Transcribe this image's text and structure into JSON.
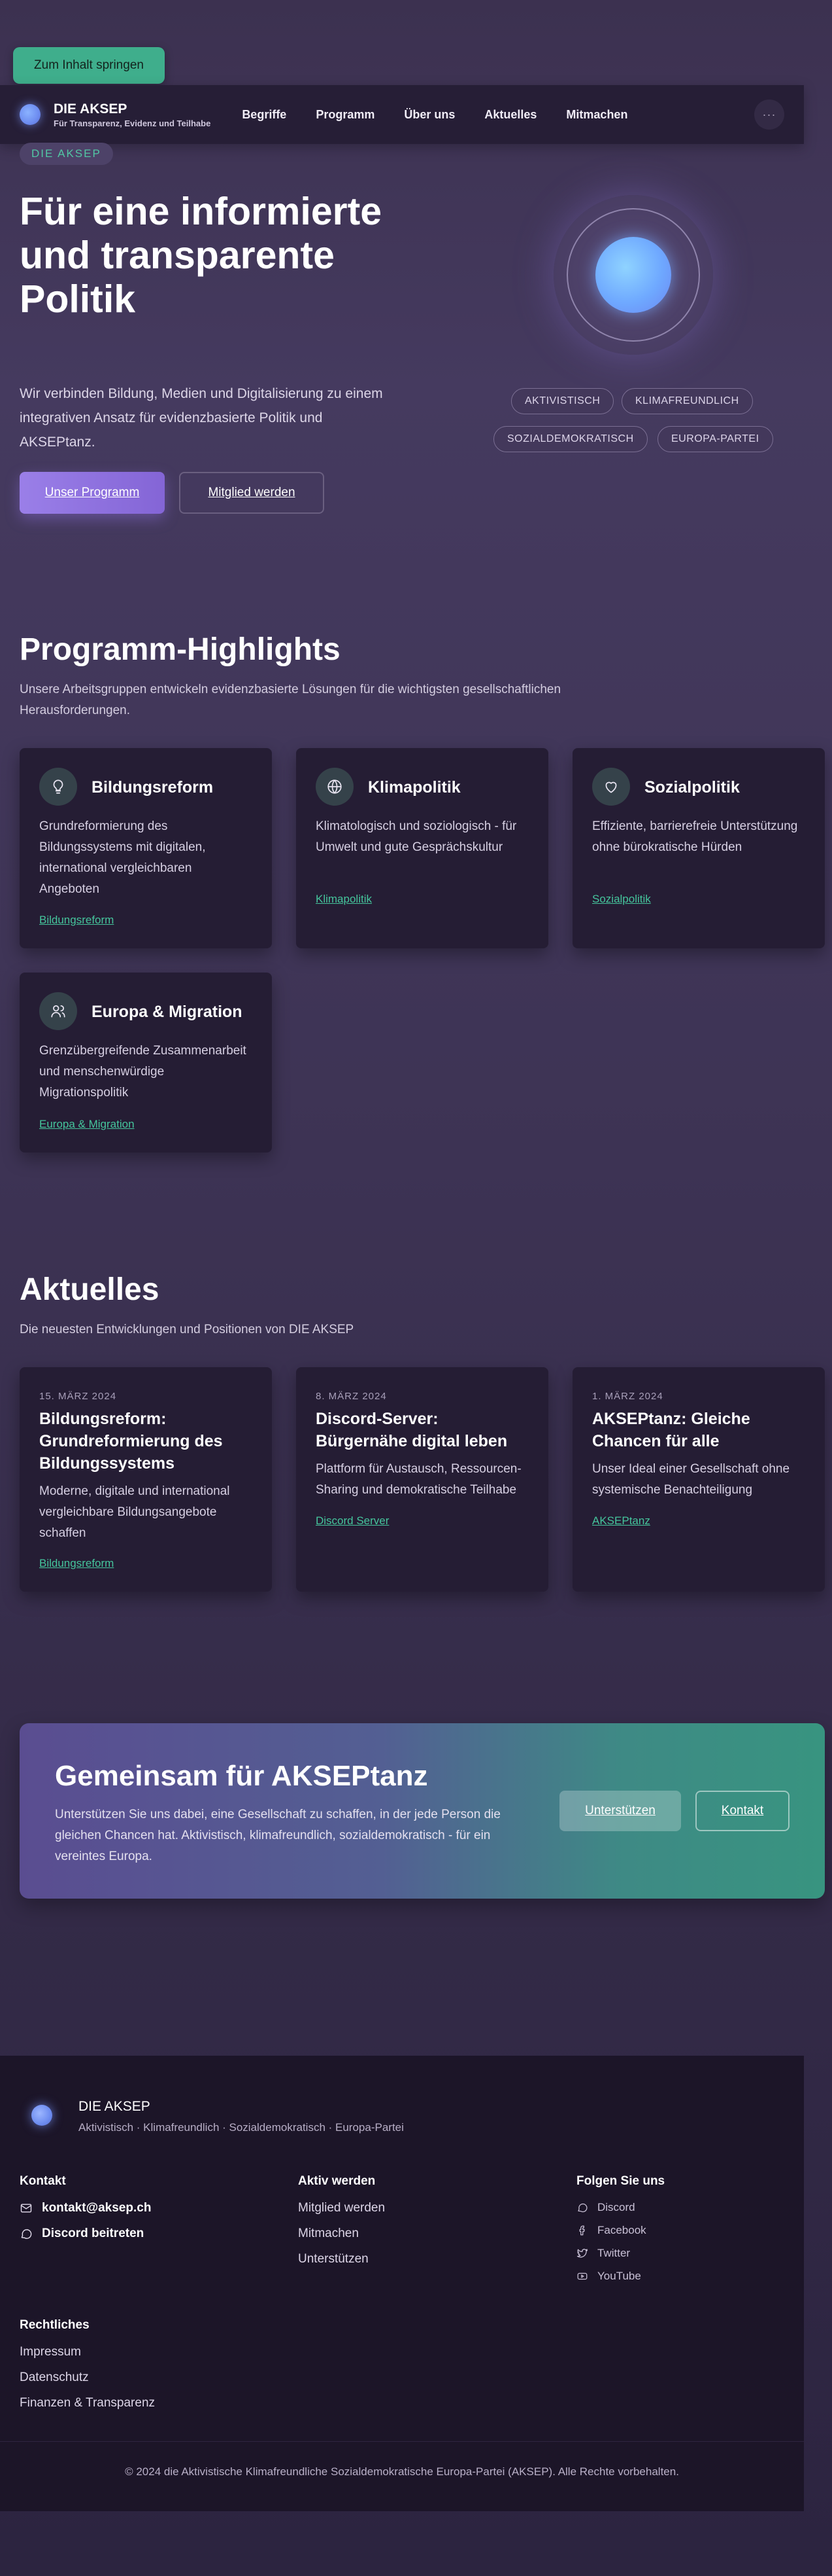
{
  "skip_link": "Zum Inhalt springen",
  "header": {
    "brand_name": "DIE AKSEP",
    "brand_tagline": "Für Transparenz, Evidenz und Teilhabe",
    "nav": [
      "Begriffe",
      "Programm",
      "Über uns",
      "Aktuelles",
      "Mitmachen"
    ],
    "menu_icon": "ellipsis-icon"
  },
  "hero": {
    "badge": "DIE AKSEP",
    "title": "Für eine informierte und transparente Politik",
    "subtitle": "Wir verbinden Bildung, Medien und Digitalisierung zu einem integrativen Ansatz für evidenzbasierte Politik und AKSEPtanz.",
    "primary_button": "Unser Programm",
    "secondary_button": "Mitglied werden",
    "pills": [
      "AKTIVISTISCH",
      "KLIMAFREUNDLICH",
      "SOZIALDEMOKRATISCH",
      "EUROPA-PARTEI"
    ]
  },
  "highlights": {
    "title": "Programm-Highlights",
    "subtitle": "Unsere Arbeitsgruppen entwickeln evidenzbasierte Lösungen für die wichtigsten gesellschaftlichen Herausforderungen.",
    "cards": [
      {
        "icon": "lightbulb-icon",
        "title": "Bildungsreform",
        "text": "Grundreformierung des Bildungssystems mit digitalen, international vergleichbaren Angeboten",
        "link": "Bildungsreform"
      },
      {
        "icon": "globe-icon",
        "title": "Klimapolitik",
        "text": "Klimatologisch und soziologisch - für Umwelt und gute Gesprächskultur",
        "link": "Klimapolitik"
      },
      {
        "icon": "heart-icon",
        "title": "Sozialpolitik",
        "text": "Effiziente, barrierefreie Unterstützung ohne bürokratische Hürden",
        "link": "Sozialpolitik"
      },
      {
        "icon": "users-icon",
        "title": "Europa & Migration",
        "text": "Grenzübergreifende Zusammenarbeit und menschenwürdige Migrationspolitik",
        "link": "Europa & Migration"
      }
    ]
  },
  "news": {
    "title": "Aktuelles",
    "subtitle": "Die neuesten Entwicklungen und Positionen von DIE AKSEP",
    "items": [
      {
        "date": "15. MÄRZ 2024",
        "title": "Bildungsreform: Grundreformierung des Bildungssystems",
        "text": "Moderne, digitale und international vergleichbare Bildungsangebote schaffen",
        "link": "Bildungsreform"
      },
      {
        "date": "8. MÄRZ 2024",
        "title": "Discord-Server: Bürgernähe digital leben",
        "text": "Plattform für Austausch, Ressourcen-Sharing und demokratische Teilhabe",
        "link": "Discord Server"
      },
      {
        "date": "1. MÄRZ 2024",
        "title": "AKSEPtanz: Gleiche Chancen für alle",
        "text": "Unser Ideal einer Gesellschaft ohne systemische Benachteiligung",
        "link": "AKSEPtanz"
      }
    ]
  },
  "cta": {
    "title": "Gemeinsam für AKSEPtanz",
    "text": "Unterstützen Sie uns dabei, eine Gesellschaft zu schaffen, in der jede Person die gleichen Chancen hat. Aktivistisch, klimafreundlich, sozialdemokratisch - für ein vereintes Europa.",
    "primary_button": "Unterstützen",
    "secondary_button": "Kontakt"
  },
  "footer": {
    "brand": "DIE AKSEP",
    "tagline": "Aktivistisch · Klimafreundlich · Sozialdemokratisch · Europa-Partei",
    "contact": {
      "title": "Kontakt",
      "email": "kontakt@aksep.ch",
      "discord": "Discord beitreten"
    },
    "involved": {
      "title": "Aktiv werden",
      "links": [
        "Mitglied werden",
        "Mitmachen",
        "Unterstützen"
      ]
    },
    "social": {
      "title": "Folgen Sie uns",
      "links": [
        "Discord",
        "Facebook",
        "Twitter",
        "YouTube"
      ]
    },
    "legal": {
      "title": "Rechtliches",
      "links": [
        "Impressum",
        "Datenschutz",
        "Finanzen & Transparenz"
      ]
    },
    "copyright": "© 2024 die Aktivistische Klimafreundliche Sozialdemokratische Europa-Partei (AKSEP). Alle Rechte vorbehalten."
  }
}
